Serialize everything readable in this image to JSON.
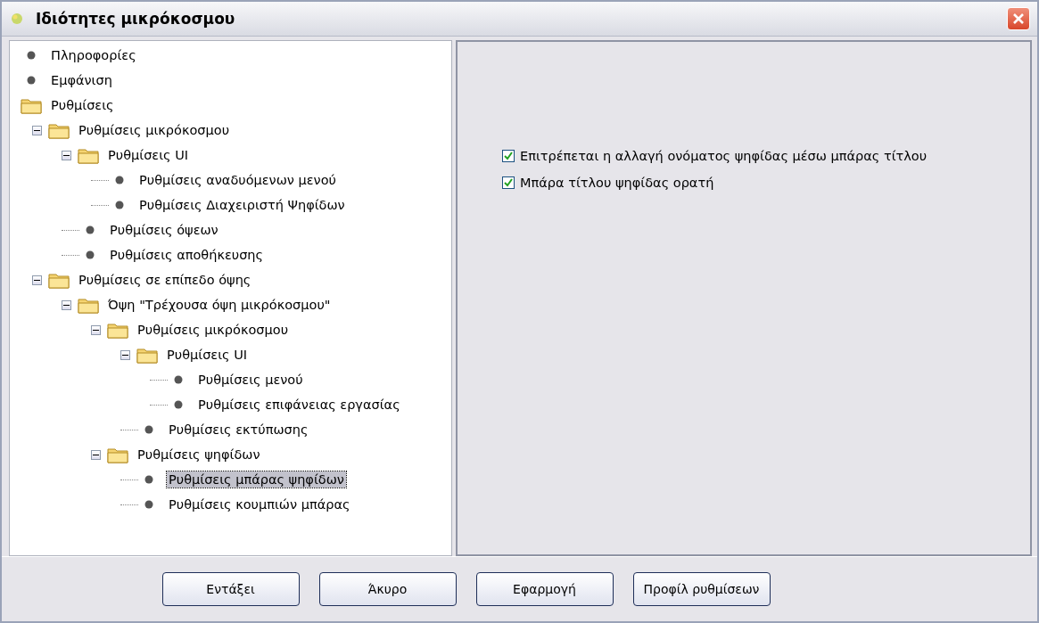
{
  "window": {
    "title": "Ιδιότητες μικρόκοσμου"
  },
  "tree": [
    {
      "label": "Πληροφορίες",
      "kind": "leaf",
      "selected": false
    },
    {
      "label": "Εμφάνιση",
      "kind": "leaf",
      "selected": false
    },
    {
      "label": "Ρυθμίσεις",
      "kind": "folder",
      "selected": false,
      "children": [
        {
          "label": "Ρυθμίσεις μικρόκοσμου",
          "kind": "folder",
          "expanded": true,
          "selected": false,
          "children": [
            {
              "label": "Ρυθμίσεις UI",
              "kind": "folder",
              "expanded": true,
              "selected": false,
              "children": [
                {
                  "label": "Ρυθμίσεις αναδυόμενων μενού",
                  "kind": "leaf",
                  "selected": false
                },
                {
                  "label": "Ρυθμίσεις Διαχειριστή Ψηφίδων",
                  "kind": "leaf",
                  "selected": false
                }
              ]
            },
            {
              "label": "Ρυθμίσεις όψεων",
              "kind": "leaf",
              "selected": false
            },
            {
              "label": "Ρυθμίσεις αποθήκευσης",
              "kind": "leaf",
              "selected": false
            }
          ]
        },
        {
          "label": "Ρυθμίσεις σε επίπεδο όψης",
          "kind": "folder",
          "expanded": true,
          "selected": false,
          "children": [
            {
              "label": "Όψη \"Τρέχουσα όψη μικρόκοσμου\"",
              "kind": "folder",
              "expanded": true,
              "selected": false,
              "children": [
                {
                  "label": "Ρυθμίσεις μικρόκοσμου",
                  "kind": "folder",
                  "expanded": true,
                  "selected": false,
                  "children": [
                    {
                      "label": "Ρυθμίσεις UI",
                      "kind": "folder",
                      "expanded": true,
                      "selected": false,
                      "children": [
                        {
                          "label": "Ρυθμίσεις μενού",
                          "kind": "leaf",
                          "selected": false
                        },
                        {
                          "label": "Ρυθμίσεις επιφάνειας εργασίας",
                          "kind": "leaf",
                          "selected": false
                        }
                      ]
                    },
                    {
                      "label": "Ρυθμίσεις εκτύπωσης",
                      "kind": "leaf",
                      "selected": false
                    }
                  ]
                },
                {
                  "label": "Ρυθμίσεις ψηφίδων",
                  "kind": "folder",
                  "expanded": true,
                  "selected": false,
                  "children": [
                    {
                      "label": "Ρυθμίσεις μπάρας ψηφίδων",
                      "kind": "leaf",
                      "selected": true
                    },
                    {
                      "label": "Ρυθμίσεις κουμπιών μπάρας",
                      "kind": "leaf",
                      "selected": false
                    }
                  ]
                }
              ]
            }
          ]
        }
      ]
    }
  ],
  "options": [
    {
      "label": "Επιτρέπεται η αλλαγή ονόματος ψηφίδας μέσω μπάρας τίτλου",
      "checked": true
    },
    {
      "label": "Μπάρα τίτλου ψηφίδας ορατή",
      "checked": true
    }
  ],
  "buttons": [
    "Εντάξει",
    "Άκυρο",
    "Εφαρμογή",
    "Προφίλ ρυθμίσεων"
  ]
}
